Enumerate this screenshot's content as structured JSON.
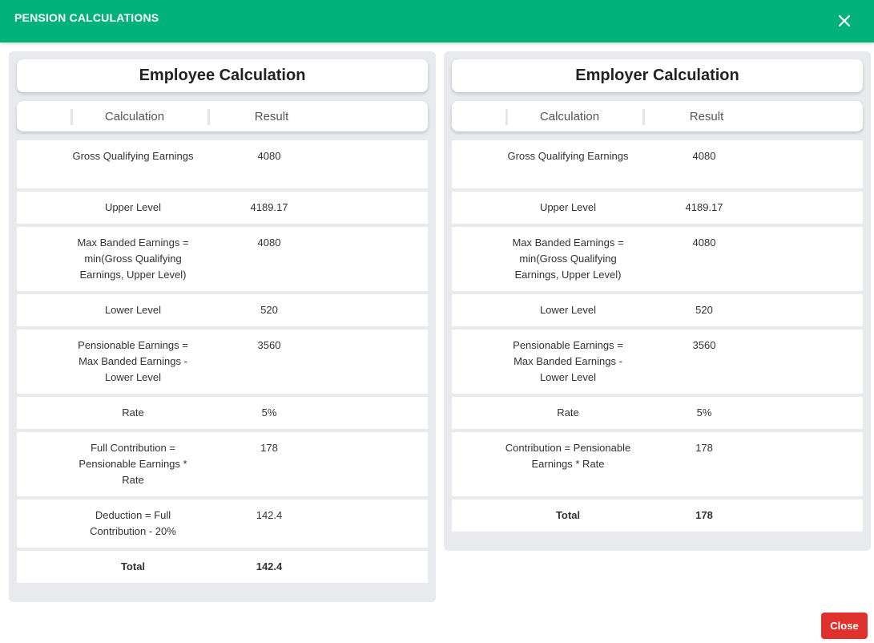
{
  "header": {
    "title": "PENSION CALCULATIONS",
    "close_icon": "close-icon"
  },
  "column_headers": {
    "calculation": "Calculation",
    "result": "Result"
  },
  "employee": {
    "title": "Employee Calculation",
    "rows": [
      {
        "calculation": "Gross Qualifying Earnings",
        "result": "4080"
      },
      {
        "calculation": "Upper Level",
        "result": "4189.17"
      },
      {
        "calculation": "Max Banded Earnings = min(Gross Qualifying Earnings, Upper Level)",
        "result": "4080"
      },
      {
        "calculation": "Lower Level",
        "result": "520"
      },
      {
        "calculation": "Pensionable Earnings = Max Banded Earnings - Lower Level",
        "result": "3560"
      },
      {
        "calculation": "Rate",
        "result": "5%"
      },
      {
        "calculation": "Full Contribution = Pensionable Earnings * Rate",
        "result": "178"
      },
      {
        "calculation": "Deduction = Full Contribution - 20%",
        "result": "142.4"
      },
      {
        "calculation": "Total",
        "result": "142.4"
      }
    ]
  },
  "employer": {
    "title": "Employer Calculation",
    "rows": [
      {
        "calculation": "Gross Qualifying Earnings",
        "result": "4080"
      },
      {
        "calculation": "Upper Level",
        "result": "4189.17"
      },
      {
        "calculation": "Max Banded Earnings = min(Gross Qualifying Earnings, Upper Level)",
        "result": "4080"
      },
      {
        "calculation": "Lower Level",
        "result": "520"
      },
      {
        "calculation": "Pensionable Earnings = Max Banded Earnings - Lower Level",
        "result": "3560"
      },
      {
        "calculation": "Rate",
        "result": "5%"
      },
      {
        "calculation": "Contribution = Pensionable Earnings * Rate",
        "result": "178"
      },
      {
        "calculation": "Total",
        "result": "178"
      }
    ]
  },
  "footer": {
    "close_label": "Close"
  },
  "colors": {
    "header_bg": "#00b27a",
    "close_button_bg": "#e0322d",
    "panel_bg": "#e8eaed"
  }
}
